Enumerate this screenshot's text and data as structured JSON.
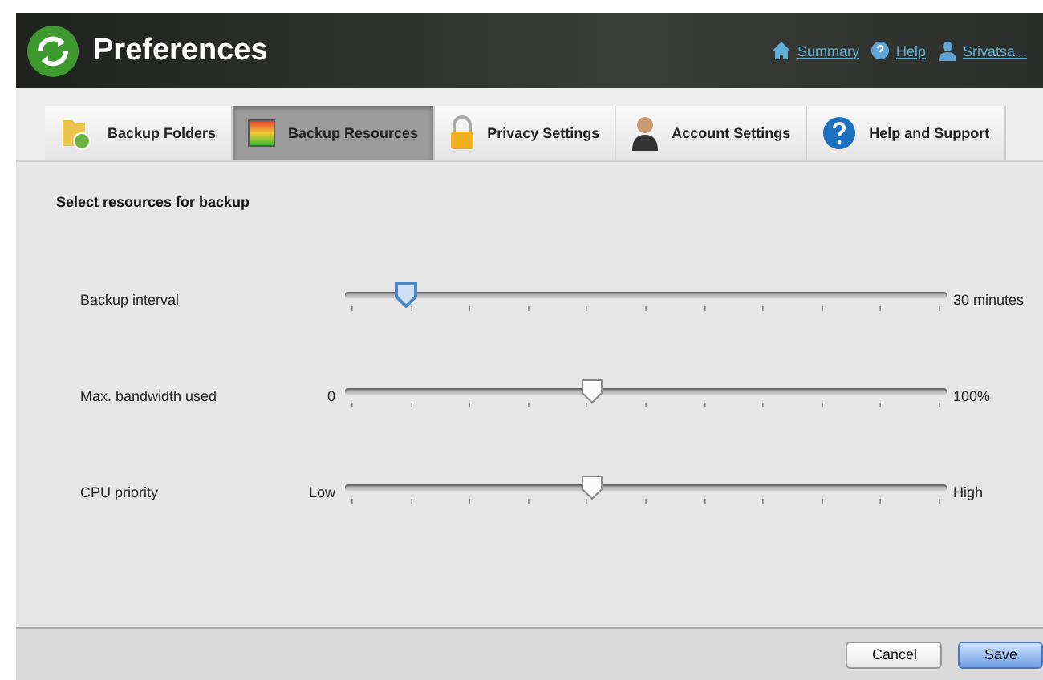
{
  "window": {
    "title": "Preferences"
  },
  "header_links": [
    {
      "kind": "home",
      "label": "Summary"
    },
    {
      "kind": "help",
      "label": "Help"
    },
    {
      "kind": "user",
      "label": "Srivatsa..."
    }
  ],
  "tabs": [
    {
      "kind": "folder",
      "label": "Backup Folders",
      "selected": false
    },
    {
      "kind": "meter",
      "label": "Backup Resources",
      "selected": true
    },
    {
      "kind": "lock",
      "label": "Privacy Settings",
      "selected": false
    },
    {
      "kind": "person",
      "label": "Account Settings",
      "selected": false
    },
    {
      "kind": "help",
      "label": "Help and Support",
      "selected": false
    }
  ],
  "section_title": "Select resources for backup",
  "sliders": [
    {
      "label": "Backup interval",
      "max_label": "30 minutes",
      "level": 0.1,
      "focused": true
    },
    {
      "label": "Max. bandwidth used",
      "min_label": "0",
      "max_label": "100%",
      "level": 0.41,
      "focused": false
    },
    {
      "label": "CPU priority",
      "min_label": "Low",
      "max_label": "High",
      "level": 0.41,
      "focused": false
    }
  ],
  "buttons": [
    {
      "label": "Cancel",
      "kind": "normal"
    },
    {
      "label": "Save",
      "kind": "default"
    }
  ]
}
